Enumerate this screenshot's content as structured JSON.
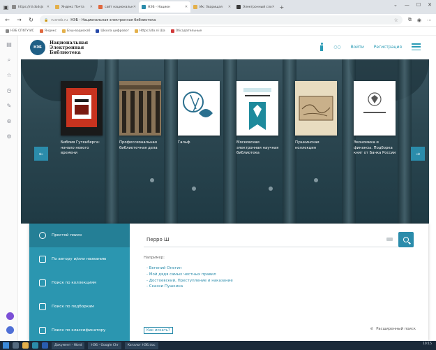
{
  "browser": {
    "tabs": [
      {
        "label": "https://rd.dsdsjs",
        "color": "#8a8a8a",
        "active": false
      },
      {
        "label": "Яндекс Почта",
        "color": "#e3b04b",
        "active": false
      },
      {
        "label": "сайт национальн",
        "color": "#e0683e",
        "active": false
      },
      {
        "label": "НЭБ - Национ",
        "color": "#2b8cab",
        "active": true
      },
      {
        "label": "Ик: Зварищая",
        "color": "#e3b04b",
        "active": false
      },
      {
        "label": "Электронный сло",
        "color": "#3a3a3a",
        "active": false
      }
    ],
    "new_tab": "+",
    "window_controls": [
      "⌄",
      "—",
      "☐",
      "✕"
    ],
    "url_prefix": "rusneb.ru",
    "url_title": "НЭБ - Национальная электронная библиотека",
    "bookmarks": [
      {
        "label": "НЭБ СПбГУ ИС",
        "color": "#888888"
      },
      {
        "label": "Яндекс",
        "color": "#e0683e"
      },
      {
        "label": "Бэш-водискаб",
        "color": "#e3b04b"
      },
      {
        "label": "Школа цифровог",
        "color": "#2749a8"
      },
      {
        "label": "Https://do.ni Ша",
        "color": "#e3b04b"
      },
      {
        "label": "Обсадательные",
        "color": "#d13a3a"
      }
    ]
  },
  "site": {
    "logo_badge": "НЭБ",
    "logo_lines": [
      "Национальная",
      "Электронная",
      "Библиотека"
    ],
    "header_links": {
      "login": "Войти",
      "register": "Регистрация"
    },
    "carousel": [
      {
        "label": "Библия Гутенберга: начало нового времени",
        "cover_bg": "#1a1a1a",
        "cover_accent": "#c8331f"
      },
      {
        "label": "Профессиональная библиотечная дела",
        "cover_bg": "#6b5a44",
        "cover_accent": "#2a241d"
      },
      {
        "label": "Гальф",
        "cover_bg": "#ffffff",
        "cover_accent": "#2a6f8e"
      },
      {
        "label": "Московская электронная научная библиотека",
        "cover_bg": "#ffffff",
        "cover_accent": "#1e8a9c"
      },
      {
        "label": "Пушкинская коллекция",
        "cover_bg": "#c9b08a",
        "cover_accent": "#6b5436"
      },
      {
        "label": "Экономика и финансы. Подборка книг от Банка России",
        "cover_bg": "#ffffff",
        "cover_accent": "#555555"
      }
    ],
    "search_nav": [
      {
        "label": "Простой поиск",
        "active": true
      },
      {
        "label": "По автору и/или названию",
        "active": false
      },
      {
        "label": "Поиск по коллекциям",
        "active": false
      },
      {
        "label": "Поиск по подборкам",
        "active": false
      },
      {
        "label": "Поиск по классификатору",
        "active": false
      }
    ],
    "search_value": "Перро Ш",
    "examples_title": "Например:",
    "examples": [
      "Евгений Онегин",
      "Мой дядя самых честных правил",
      "Достоевский, Преступление и наказание",
      "Сказки Пушкина"
    ],
    "howto": "Как искать?",
    "advanced": "Расширенный поиск"
  },
  "taskbar": {
    "windows": [
      "Документ - Word",
      "НЭБ - Google Chr",
      "Каталог НЭБ.doc"
    ],
    "clock": "10:15"
  }
}
